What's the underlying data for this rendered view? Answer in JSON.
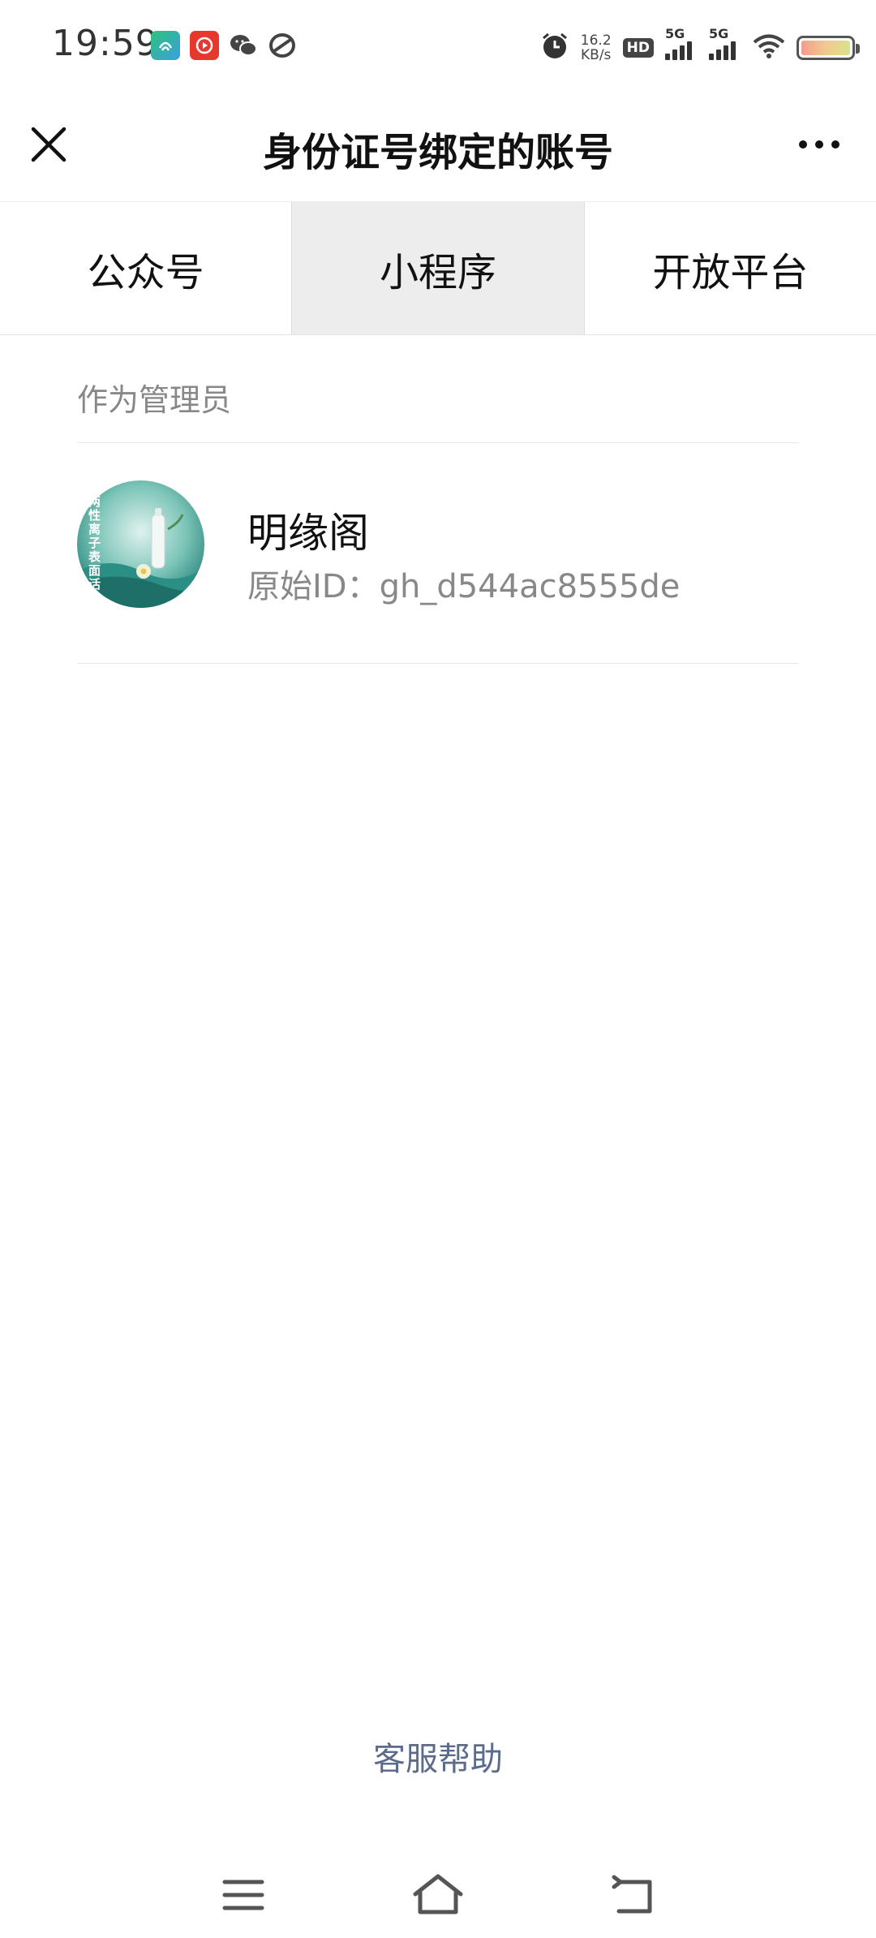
{
  "status_bar": {
    "time": "19:59",
    "net_speed_value": "16.2",
    "net_speed_unit": "KB/s",
    "hd_label": "HD",
    "sim1_label": "5G",
    "sim2_label": "5G",
    "icons": [
      "app-green-icon",
      "app-red-play-icon",
      "wechat-icon",
      "app-swirl-icon",
      "alarm-icon",
      "wifi-icon",
      "battery-icon"
    ]
  },
  "nav": {
    "title": "身份证号绑定的账号",
    "close_icon": "close-icon",
    "more_icon": "more-icon"
  },
  "tabs": [
    {
      "label": "公众号",
      "active": false
    },
    {
      "label": "小程序",
      "active": true
    },
    {
      "label": "开放平台",
      "active": false
    }
  ],
  "section": {
    "header": "作为管理员"
  },
  "account": {
    "name": "明缘阁",
    "original_id": "原始ID：gh_d544ac8555de",
    "avatar_text": "两性离子表面活"
  },
  "footer": {
    "help_link": "客服帮助"
  },
  "system_nav": {
    "icons": [
      "menu-icon",
      "home-icon",
      "back-icon"
    ]
  },
  "colors": {
    "active_tab_bg": "#ededed",
    "link_color": "#5b6b8c",
    "avatar_teal": "#2b8f86"
  }
}
